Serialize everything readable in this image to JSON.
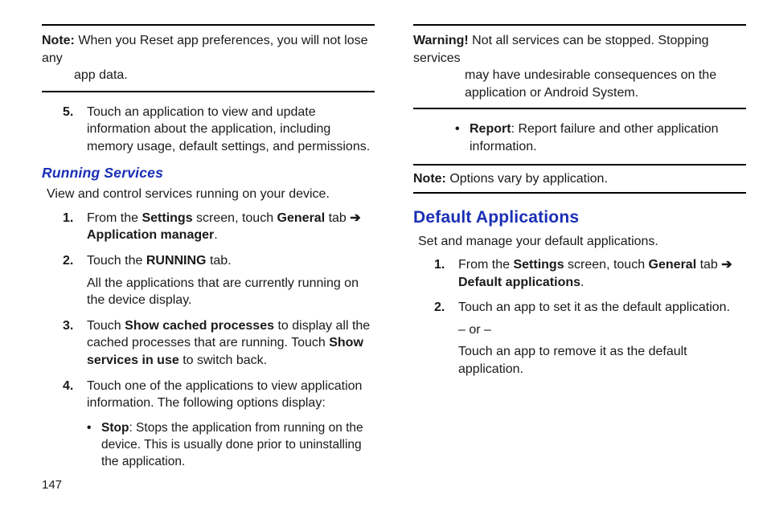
{
  "left": {
    "note_label": "Note:",
    "note_text_line1": " When you Reset app preferences, you will not lose any ",
    "note_text_line2": "app data.",
    "step5_num": "5",
    "step5": "Touch an application to view and update information about the application, including memory usage, default settings, and permissions.",
    "rs_heading": "Running Services",
    "rs_intro": "View and control services running on your device.",
    "rs1_num": "1",
    "rs1_a": "From the ",
    "rs1_settings": "Settings",
    "rs1_b": " screen, touch ",
    "rs1_general": "General",
    "rs1_tab": " tab ",
    "rs1_arrow": "➔",
    "rs1_appmgr": "Application manager",
    "rs1_period": ".",
    "rs2_num": "2",
    "rs2_a": "Touch the ",
    "rs2_running": "RUNNING",
    "rs2_b": " tab.",
    "rs2_body": "All the applications that are currently running on the device display.",
    "rs3_num": "3",
    "rs3_a": "Touch ",
    "rs3_scp": "Show cached processes",
    "rs3_b": " to display all the cached processes that are running. Touch ",
    "rs3_siu": "Show services in use",
    "rs3_c": " to switch back.",
    "rs4_num": "4",
    "rs4": "Touch one of the applications to view application information. The following options display:",
    "stop_label": "Stop",
    "stop_text": ": Stops the application from running on the device. This is usually done prior to uninstalling the application."
  },
  "right": {
    "warn_label": "Warning!",
    "warn_line1": " Not all services can be stopped. Stopping services ",
    "warn_line2": "may have undesirable consequences on the ",
    "warn_line3": "application or Android System.",
    "report_label": "Report",
    "report_text": ": Report failure and other application information.",
    "note_label": "Note:",
    "note_text": " Options vary by application.",
    "da_heading": "Default Applications",
    "da_intro": "Set and manage your default applications.",
    "da1_num": "1",
    "da1_a": "From the ",
    "da1_settings": "Settings",
    "da1_b": " screen, touch ",
    "da1_general": "General",
    "da1_tab": " tab ",
    "da1_arrow": "➔",
    "da1_defapps": "Default applications",
    "da1_period": ".",
    "da2_num": "2",
    "da2": "Touch an app to set it as the default application.",
    "da2_or": "– or –",
    "da2_alt": "Touch an app to remove it as the default application."
  },
  "page_number": "147"
}
